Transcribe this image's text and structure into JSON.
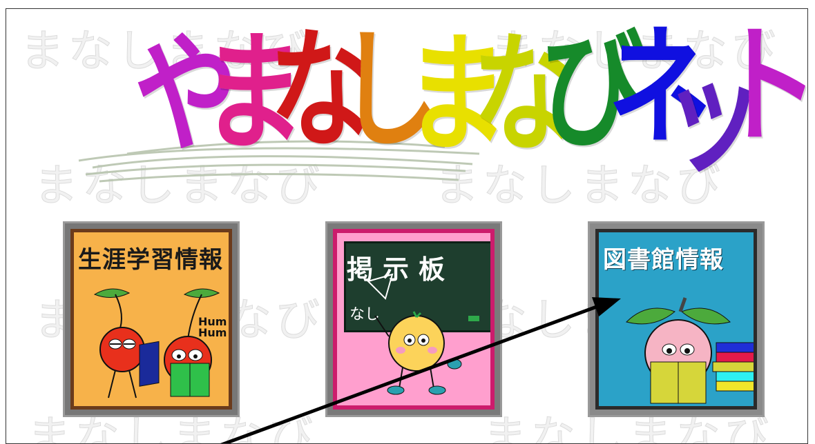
{
  "header": {
    "logo_chars": [
      {
        "char": "や",
        "color": "#c020c8"
      },
      {
        "char": "ま",
        "color": "#e0208c"
      },
      {
        "char": "な",
        "color": "#d01818"
      },
      {
        "char": "し",
        "color": "#e08010"
      },
      {
        "char": "ま",
        "color": "#e8e000"
      },
      {
        "char": "な",
        "color": "#c8d400"
      },
      {
        "char": "び",
        "color": "#168a2a"
      },
      {
        "char": "ネ",
        "color": "#1010e0"
      },
      {
        "char": "ッ",
        "color": "#6020c0"
      },
      {
        "char": "ト",
        "color": "#c020c8"
      }
    ]
  },
  "watermark_text": "まなしまなび",
  "tiles": [
    {
      "label": "生涯学習情報",
      "name": "tile-lifelong-learning",
      "bg": "#f7b24a"
    },
    {
      "label": "掲示板",
      "name": "tile-bulletin-board",
      "bg": "#ff9fce"
    },
    {
      "label": "図書館情報",
      "name": "tile-library-info",
      "bg": "#2ba2c8"
    }
  ],
  "illustrations": {
    "hum_text_line1": "Hum",
    "hum_text_line2": "Hum",
    "chalk_text": "なし"
  },
  "colors": {
    "arrow": "#000000"
  }
}
